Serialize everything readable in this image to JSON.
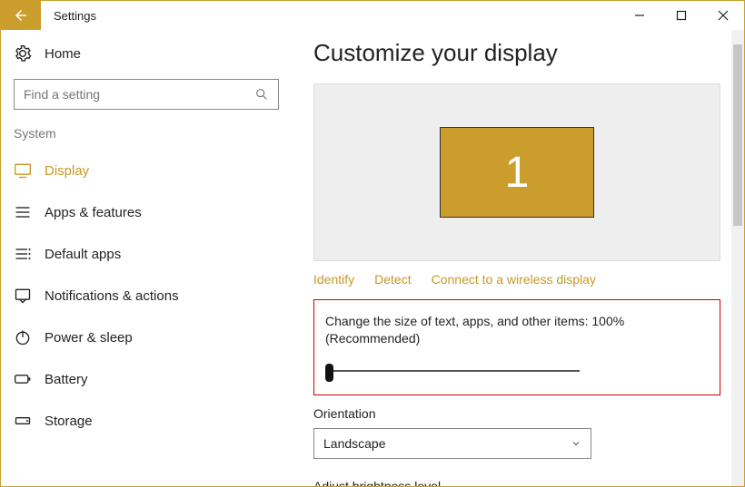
{
  "window": {
    "title": "Settings"
  },
  "sidebar": {
    "home_label": "Home",
    "search_placeholder": "Find a setting",
    "category_label": "System",
    "items": [
      {
        "label": "Display",
        "selected": true
      },
      {
        "label": "Apps & features"
      },
      {
        "label": "Default apps"
      },
      {
        "label": "Notifications & actions"
      },
      {
        "label": "Power & sleep"
      },
      {
        "label": "Battery"
      },
      {
        "label": "Storage"
      }
    ]
  },
  "main": {
    "heading": "Customize your display",
    "monitor_number": "1",
    "links": {
      "identify": "Identify",
      "detect": "Detect",
      "wireless": "Connect to a wireless display"
    },
    "scale_label": "Change the size of text, apps, and other items: 100% (Recommended)",
    "orientation_label": "Orientation",
    "orientation_value": "Landscape",
    "brightness_label": "Adjust brightness level"
  }
}
